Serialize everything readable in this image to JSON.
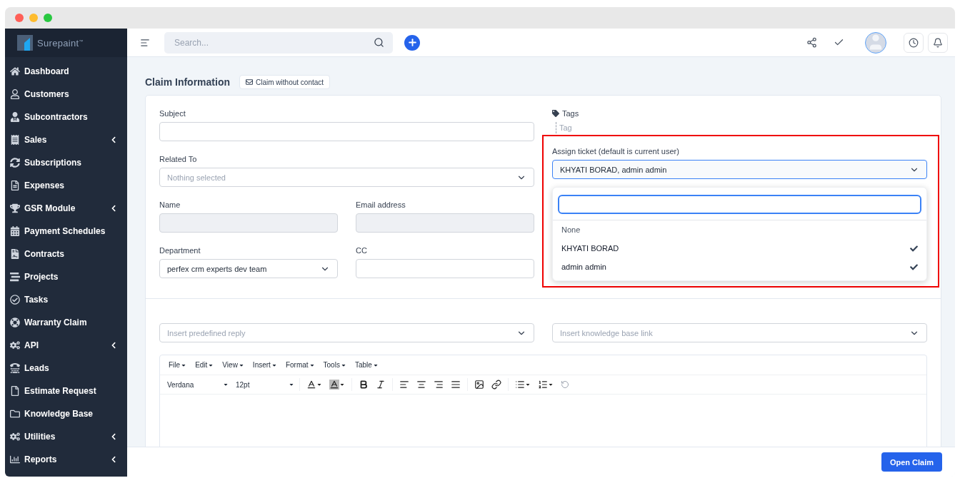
{
  "sidebar": {
    "logo": "Surepaint$^{™}$",
    "items": [
      {
        "label": "Dashboard",
        "submenu": false
      },
      {
        "label": "Customers",
        "submenu": false
      },
      {
        "label": "Subcontractors",
        "submenu": false
      },
      {
        "label": "Sales",
        "submenu": true
      },
      {
        "label": "Subscriptions",
        "submenu": false
      },
      {
        "label": "Expenses",
        "submenu": false
      },
      {
        "label": "GSR Module",
        "submenu": true
      },
      {
        "label": "Payment Schedules",
        "submenu": false
      },
      {
        "label": "Contracts",
        "submenu": false
      },
      {
        "label": "Projects",
        "submenu": false
      },
      {
        "label": "Tasks",
        "submenu": false
      },
      {
        "label": "Warranty Claim",
        "submenu": false
      },
      {
        "label": "API",
        "submenu": true
      },
      {
        "label": "Leads",
        "submenu": false
      },
      {
        "label": "Estimate Request",
        "submenu": false
      },
      {
        "label": "Knowledge Base",
        "submenu": false
      },
      {
        "label": "Utilities",
        "submenu": true
      },
      {
        "label": "Reports",
        "submenu": true
      }
    ]
  },
  "topbar": {
    "search_placeholder": "Search..."
  },
  "page": {
    "title": "Claim Information",
    "mode_button": "Claim without contact"
  },
  "form": {
    "subject": {
      "label": "Subject"
    },
    "related_to": {
      "label": "Related To",
      "placeholder": "Nothing selected"
    },
    "name": {
      "label": "Name"
    },
    "email": {
      "label": "Email address"
    },
    "department": {
      "label": "Department",
      "value": "perfex crm experts dev team"
    },
    "cc": {
      "label": "CC"
    },
    "tags": {
      "label": "Tags",
      "placeholder": "Tag"
    },
    "assign": {
      "label": "Assign ticket (default is current user)",
      "value": "KHYATI BORAD, admin admin",
      "expanded": true,
      "options": [
        {
          "label": "None",
          "selected": false
        },
        {
          "label": "KHYATI BORAD",
          "selected": true
        },
        {
          "label": "admin admin",
          "selected": true
        }
      ]
    }
  },
  "reply": {
    "predefined_placeholder": "Insert predefined reply",
    "knowledge_placeholder": "Insert knowledge base link"
  },
  "editor": {
    "menus": [
      "File",
      "Edit",
      "View",
      "Insert",
      "Format",
      "Tools",
      "Table"
    ],
    "font": "Verdana",
    "size": "12pt"
  },
  "footer": {
    "submit": "Open Claim"
  }
}
